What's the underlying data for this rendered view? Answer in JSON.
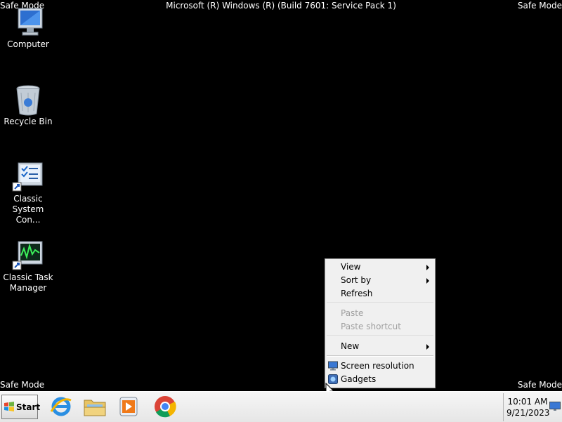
{
  "banner": "Microsoft (R) Windows (R) (Build 7601: Service Pack 1)",
  "safe_mode": "Safe Mode",
  "desktop_icons": [
    {
      "label": "Computer",
      "icon": "computer-icon"
    },
    {
      "label": "Recycle Bin",
      "icon": "recycle-bin-icon"
    },
    {
      "label": "Classic System Con...",
      "icon": "system-config-icon"
    },
    {
      "label": "Classic Task Manager",
      "icon": "task-manager-icon"
    }
  ],
  "context_menu": {
    "items": [
      {
        "label": "View",
        "submenu": true,
        "enabled": true
      },
      {
        "label": "Sort by",
        "submenu": true,
        "enabled": true
      },
      {
        "label": "Refresh",
        "enabled": true
      },
      {
        "label": "Paste",
        "enabled": false
      },
      {
        "label": "Paste shortcut",
        "enabled": false
      },
      {
        "label": "New",
        "submenu": true,
        "enabled": true
      },
      {
        "label": "Screen resolution",
        "enabled": true,
        "icon": "display-icon"
      },
      {
        "label": "Gadgets",
        "enabled": true,
        "icon": "gadgets-icon"
      }
    ]
  },
  "taskbar": {
    "start_label": "Start",
    "pinned": [
      "internet-explorer-icon",
      "file-explorer-icon",
      "media-player-icon",
      "chrome-icon"
    ],
    "clock_time": "10:01 AM",
    "clock_date": "9/21/2023"
  }
}
